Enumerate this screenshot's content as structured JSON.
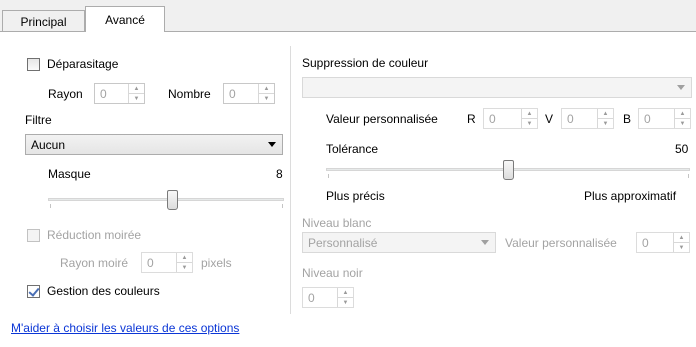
{
  "tabs": [
    {
      "label": "Principal"
    },
    {
      "label": "Avancé"
    }
  ],
  "left": {
    "despeckle": {
      "label": "Déparasitage",
      "checked": false
    },
    "rayon": {
      "label": "Rayon",
      "value": "0"
    },
    "nombre": {
      "label": "Nombre",
      "value": "0"
    },
    "filtre": {
      "label": "Filtre",
      "selected": "Aucun"
    },
    "masque": {
      "label": "Masque",
      "value": "8",
      "level": 0.58
    },
    "moire": {
      "label": "Réduction moirée",
      "checked": false
    },
    "rayon_moire": {
      "label": "Rayon moiré",
      "value": "0",
      "unit": "pixels"
    },
    "gestion": {
      "label": "Gestion des couleurs",
      "checked": true
    },
    "help_link": "M'aider à choisir les valeurs de ces options"
  },
  "right": {
    "suppression": {
      "label": "Suppression de couleur",
      "selected": ""
    },
    "valeur_perso": {
      "label": "Valeur personnalisée",
      "r_label": "R",
      "r_value": "0",
      "v_label": "V",
      "v_value": "0",
      "b_label": "B",
      "b_value": "0"
    },
    "tolerance": {
      "label": "Tolérance",
      "value": "50",
      "level": 0.5
    },
    "plus_precis": "Plus précis",
    "plus_approx": "Plus approximatif",
    "niveau_blanc": {
      "label": "Niveau blanc",
      "selected": "Personnalisé",
      "custom_label": "Valeur personnalisée",
      "custom_value": "0"
    },
    "niveau_noir": {
      "label": "Niveau noir",
      "value": "0"
    }
  },
  "spin_icons": {
    "up": "▲",
    "down": "▼"
  }
}
